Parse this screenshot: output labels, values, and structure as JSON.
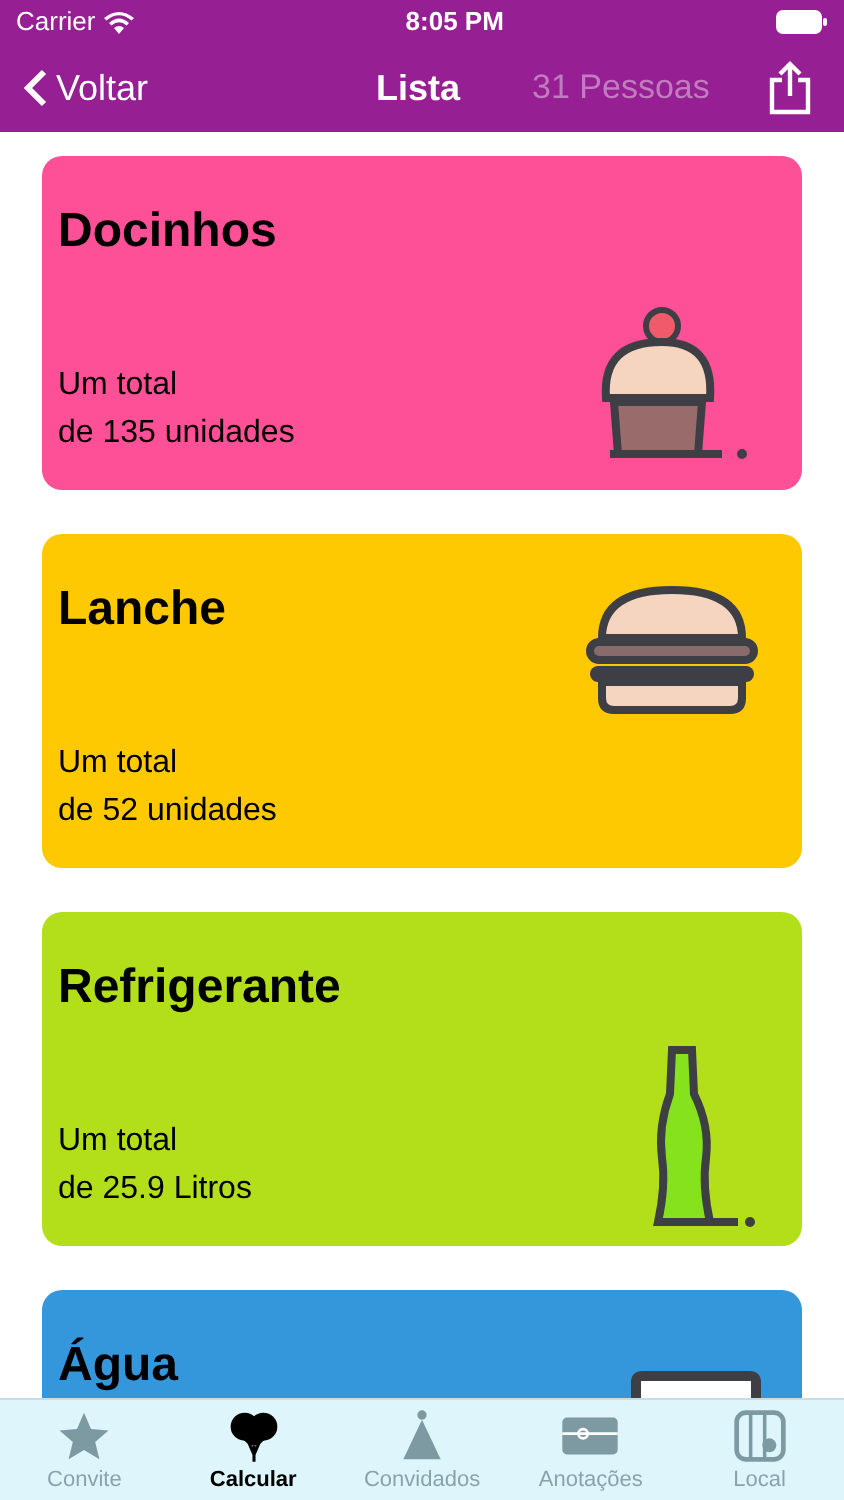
{
  "status_bar": {
    "carrier": "Carrier",
    "time": "8:05 PM"
  },
  "nav": {
    "back": "Voltar",
    "title": "Lista",
    "subtitle": "31 Pessoas"
  },
  "cards": [
    {
      "title": "Docinhos",
      "lines": [
        "Um total",
        "de 135 unidades"
      ],
      "kind": "cupcake",
      "color": "#fe5097"
    },
    {
      "title": "Lanche",
      "lines": [
        "Um total",
        "de 52 unidades"
      ],
      "kind": "burger",
      "color": "#ffc902"
    },
    {
      "title": "Refrigerante",
      "lines": [
        "Um total",
        "de 25.9 Litros"
      ],
      "kind": "bottle",
      "color": "#b3de1a"
    },
    {
      "title": "Água",
      "kind": "water",
      "color": "#3597db"
    }
  ],
  "tabs": [
    {
      "label": "Convite",
      "kind": "star",
      "selected": false
    },
    {
      "label": "Calcular",
      "kind": "balloons",
      "selected": true
    },
    {
      "label": "Convidados",
      "kind": "hat",
      "selected": false
    },
    {
      "label": "Anotações",
      "kind": "gift",
      "selected": false
    },
    {
      "label": "Local",
      "kind": "map",
      "selected": false
    }
  ]
}
